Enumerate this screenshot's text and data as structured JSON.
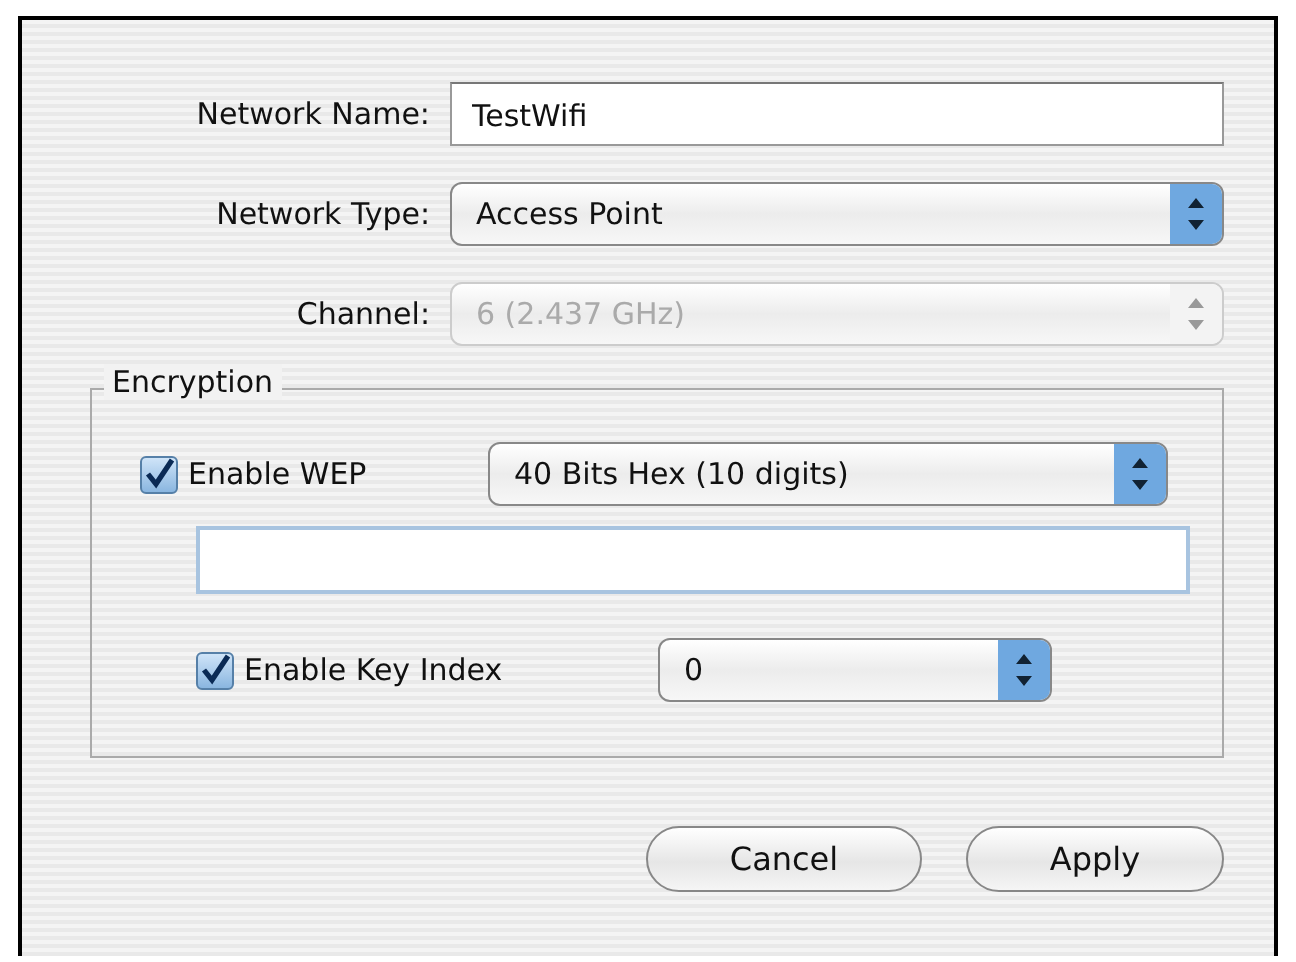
{
  "fields": [
    {
      "kind": "text",
      "label": "Network Name:",
      "value": "TestWifi",
      "disabled": false
    },
    {
      "kind": "popup",
      "label": "Network Type:",
      "value": "Access Point",
      "disabled": false
    },
    {
      "kind": "popup",
      "label": "Channel:",
      "value": "6 (2.437 GHz)",
      "disabled": true
    }
  ],
  "encryption": {
    "title": "Encryption",
    "wep": {
      "label": "Enable WEP",
      "checked": true,
      "popup": "40 Bits Hex (10 digits)"
    },
    "key_index": {
      "label": "Enable Key Index",
      "checked": true,
      "popup": "0"
    }
  },
  "buttons": [
    {
      "label": "Cancel",
      "kind": "plain"
    },
    {
      "label": "Apply",
      "kind": "plain"
    }
  ]
}
